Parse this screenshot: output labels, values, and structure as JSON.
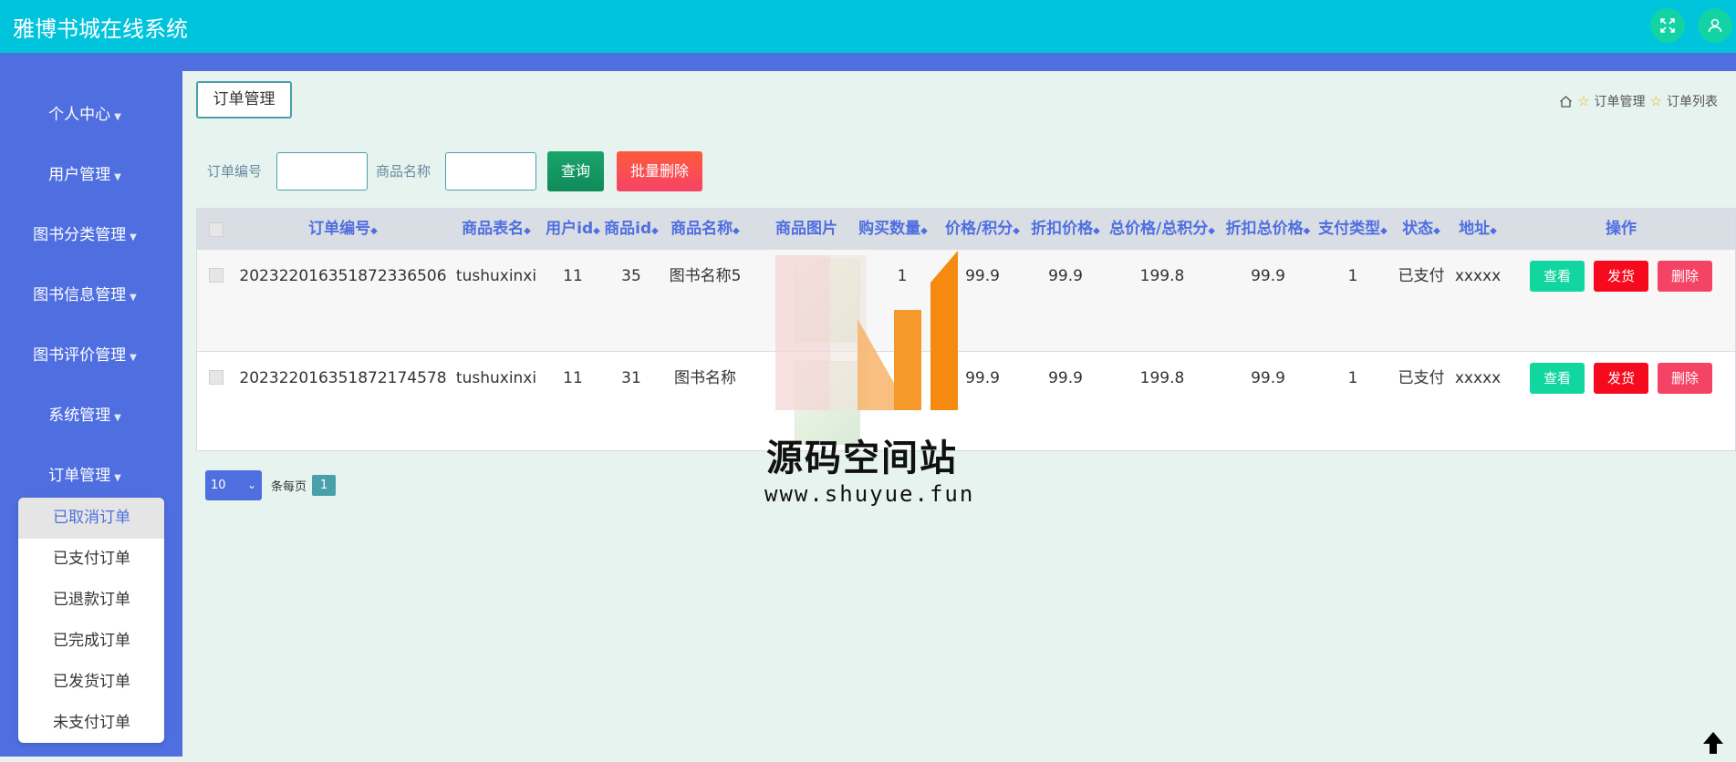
{
  "app": {
    "title": "雅博书城在线系统"
  },
  "header_icons": {
    "fullscreen": "fullscreen-icon",
    "user": "user-icon"
  },
  "sidebar": {
    "items": [
      {
        "label": "个人中心"
      },
      {
        "label": "用户管理"
      },
      {
        "label": "图书分类管理"
      },
      {
        "label": "图书信息管理"
      },
      {
        "label": "图书评价管理"
      },
      {
        "label": "系统管理"
      },
      {
        "label": "订单管理"
      }
    ],
    "submenu": [
      {
        "label": "已取消订单",
        "active": true
      },
      {
        "label": "已支付订单"
      },
      {
        "label": "已退款订单"
      },
      {
        "label": "已完成订单"
      },
      {
        "label": "已发货订单"
      },
      {
        "label": "未支付订单"
      }
    ]
  },
  "page": {
    "tag": "订单管理",
    "breadcrumb": [
      "订单管理",
      "订单列表"
    ]
  },
  "search": {
    "order_no_label": "订单编号",
    "product_name_label": "商品名称",
    "query_label": "查询",
    "batch_delete_label": "批量删除"
  },
  "table": {
    "headers": [
      "订单编号",
      "商品表名",
      "用户id",
      "商品id",
      "商品名称",
      "商品图片",
      "购买数量",
      "价格/积分",
      "折扣价格",
      "总价格/总积分",
      "折扣总价格",
      "支付类型",
      "状态",
      "地址",
      "操作"
    ],
    "rows": [
      {
        "order_no": "20232201635187233650​6",
        "table_name": "tushuxinxi",
        "user_id": "11",
        "product_id": "35",
        "product_name": "图书名称5",
        "qty": "1",
        "price": "99.9",
        "discount_price": "99.9",
        "total": "199.8",
        "discount_total": "99.9",
        "pay_type": "1",
        "status": "已支付",
        "address": "xxxxx"
      },
      {
        "order_no": "202322016351872174578",
        "table_name": "tushuxinxi",
        "user_id": "11",
        "product_id": "31",
        "product_name": "图书名称",
        "qty": "1",
        "price": "99.9",
        "discount_price": "99.9",
        "total": "199.8",
        "discount_total": "99.9",
        "pay_type": "1",
        "status": "已支付",
        "address": "xxxxx"
      }
    ],
    "actions": {
      "view": "查看",
      "ship": "发货",
      "delete": "删除"
    }
  },
  "pagination": {
    "page_size": "10",
    "per_page_label": "条每页",
    "current_page": "1"
  },
  "watermark": {
    "name": "源码空间站",
    "url": "www.shuyue.fun"
  },
  "colors": {
    "header": "#00c3dc",
    "sidebar": "#4f6fe0",
    "content_bg": "#e6f3ee",
    "view": "#12d6a0",
    "ship": "#f50a1e",
    "delete": "#f54366"
  }
}
